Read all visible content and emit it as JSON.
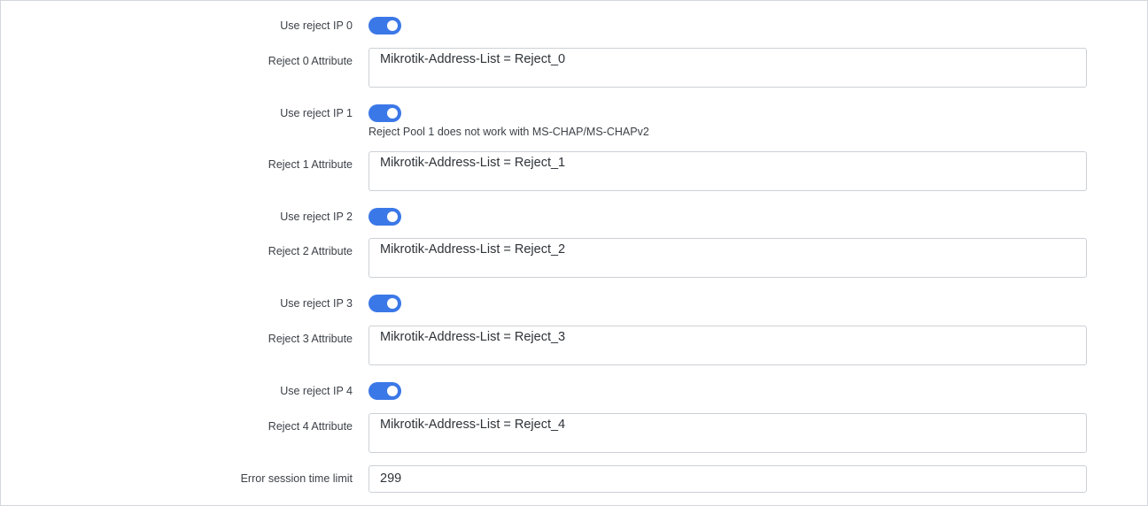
{
  "fields": {
    "use_reject_0": {
      "label": "Use reject IP 0",
      "enabled": true
    },
    "attr_0": {
      "label": "Reject 0 Attribute",
      "value": "Mikrotik-Address-List = Reject_0"
    },
    "use_reject_1": {
      "label": "Use reject IP 1",
      "enabled": true,
      "help": "Reject Pool 1 does not work with MS-CHAP/MS-CHAPv2"
    },
    "attr_1": {
      "label": "Reject 1 Attribute",
      "value": "Mikrotik-Address-List = Reject_1"
    },
    "use_reject_2": {
      "label": "Use reject IP 2",
      "enabled": true
    },
    "attr_2": {
      "label": "Reject 2 Attribute",
      "value": "Mikrotik-Address-List = Reject_2"
    },
    "use_reject_3": {
      "label": "Use reject IP 3",
      "enabled": true
    },
    "attr_3": {
      "label": "Reject 3 Attribute",
      "value": "Mikrotik-Address-List = Reject_3"
    },
    "use_reject_4": {
      "label": "Use reject IP 4",
      "enabled": true
    },
    "attr_4": {
      "label": "Reject 4 Attribute",
      "value": "Mikrotik-Address-List = Reject_4"
    },
    "error_session": {
      "label": "Error session time limit",
      "value": "299"
    }
  },
  "colors": {
    "toggle_on": "#3b78e7",
    "border": "#ccd0d5"
  }
}
